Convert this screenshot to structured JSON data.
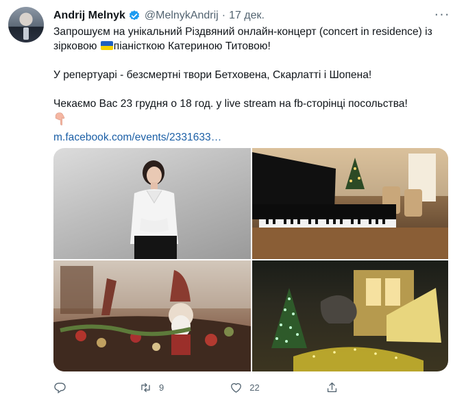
{
  "tweet": {
    "author_name": "Andrij Melnyk",
    "author_handle": "@MelnykAndrij",
    "separator": "·",
    "date": "17 дек.",
    "more_label": "···",
    "line1_a": "Запрошуєм на унікальний Різдвяний онлайн-концерт (concert in residence) із зірковою ",
    "line1_b": "піаністкою Катериною Титовою!",
    "line2": "У репертуарі - безсмертні твори Бетховена, Скарлатті і Шопена!",
    "line3": "Чекаємо Вас 23 грудня о 18 год. у live stream на fb-сторінці посольства!",
    "link": "m.facebook.com/events/2331633…"
  },
  "actions": {
    "reply_count": "",
    "retweet_count": "9",
    "like_count": "22"
  },
  "colors": {
    "text": "#0f1419",
    "secondary": "#536471",
    "link": "#1b5fa6",
    "verified": "#1d9bf0",
    "flag_blue": "#1f5fbf",
    "flag_yellow": "#f6d200"
  }
}
